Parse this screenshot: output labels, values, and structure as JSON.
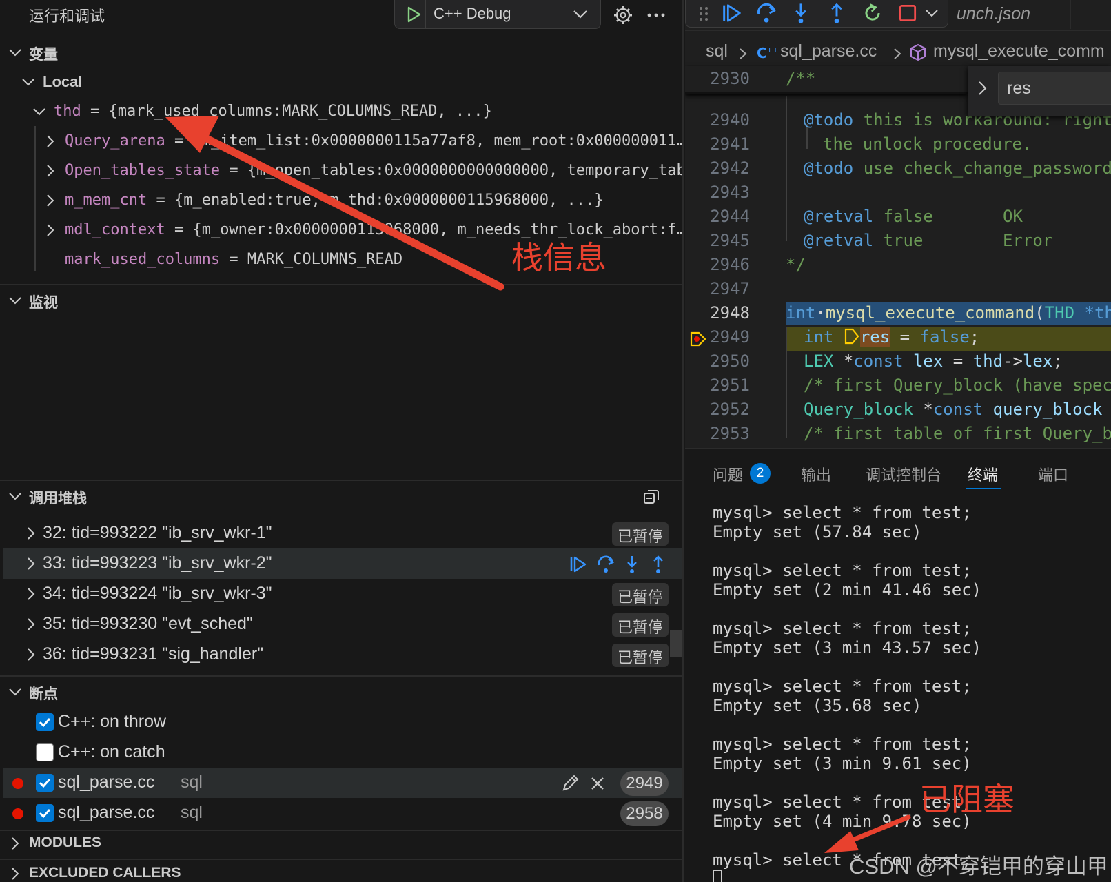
{
  "sidebar": {
    "title": "运行和调试",
    "launch_config": "C++ Debug",
    "sections": {
      "variables": "变量",
      "local": "Local",
      "watch": "监视",
      "call_stack": "调用堆栈",
      "breakpoints": "断点",
      "modules": "MODULES",
      "excluded_callers": "EXCLUDED CALLERS"
    }
  },
  "variables": {
    "thd": {
      "name": "thd",
      "value": "{mark_used_columns:MARK_COLUMNS_READ, ...}"
    },
    "children": [
      {
        "name": "Query_arena",
        "value": "{m_item_list:0x0000000115a77af8, mem_root:0x000000011…"
      },
      {
        "name": "Open_tables_state",
        "value": "{m_open_tables:0x0000000000000000, temporary_tabl…"
      },
      {
        "name": "m_mem_cnt",
        "value": "{m_enabled:true, m_thd:0x0000000115968000, ...}"
      },
      {
        "name": "mdl_context",
        "value": "{m_owner:0x0000000115968000, m_needs_thr_lock_abort:f…"
      },
      {
        "name": "mark_used_columns",
        "value": "MARK_COLUMNS_READ"
      }
    ]
  },
  "threads": [
    {
      "label": "32: tid=993222 \"ib_srv_wkr-1\"",
      "status": "已暂停"
    },
    {
      "label": "33: tid=993223 \"ib_srv_wkr-2\"",
      "status": ""
    },
    {
      "label": "34: tid=993224 \"ib_srv_wkr-3\"",
      "status": "已暂停"
    },
    {
      "label": "35: tid=993230 \"evt_sched\"",
      "status": "已暂停"
    },
    {
      "label": "36: tid=993231 \"sig_handler\"",
      "status": "已暂停"
    }
  ],
  "breakpoints": [
    {
      "label": "C++: on throw",
      "checked": true
    },
    {
      "label": "C++: on catch",
      "checked": false
    },
    {
      "label": "sql_parse.cc",
      "path": "sql",
      "line": "2949",
      "checked": true
    },
    {
      "label": "sql_parse.cc",
      "path": "sql",
      "line": "2958",
      "checked": true
    }
  ],
  "editor": {
    "tab_fragment": "unch.json",
    "breadcrumb": [
      "sql",
      "sql_parse.cc",
      "mysql_execute_comm"
    ],
    "sticky_line": {
      "num": "2930",
      "text": "/**"
    },
    "find_value": "res",
    "lines": [
      {
        "num": "2940",
        "text": "@todo this is workaround: right"
      },
      {
        "num": "2941",
        "text": "the unlock procedure."
      },
      {
        "num": "2942",
        "text": "@todo use check_change_password"
      },
      {
        "num": "2943",
        "text": ""
      },
      {
        "num": "2944",
        "text": "@retval false       OK"
      },
      {
        "num": "2945",
        "text": "@retval true        Error"
      },
      {
        "num": "2946",
        "text": "*/"
      },
      {
        "num": "2947",
        "text": ""
      },
      {
        "num": "2948",
        "text": "int mysql_execute_command(THD *th"
      },
      {
        "num": "2949",
        "text": "int res = false;"
      },
      {
        "num": "2950",
        "text": "LEX *const lex = thd->lex;"
      },
      {
        "num": "2951",
        "text": "/* first Query_block (have spec"
      },
      {
        "num": "2952",
        "text": "Query_block *const query_block"
      },
      {
        "num": "2953",
        "text": "/* first table of first Query_b"
      }
    ]
  },
  "panel": {
    "tabs": [
      "问题",
      "输出",
      "调试控制台",
      "终端",
      "端口"
    ],
    "problems_count": "2",
    "active_tab": "终端",
    "terminal": [
      "mysql> select * from test;",
      "Empty set (57.84 sec)",
      "",
      "mysql> select * from test;",
      "Empty set (2 min 41.46 sec)",
      "",
      "mysql> select * from test;",
      "Empty set (3 min 43.57 sec)",
      "",
      "mysql> select * from test;",
      "Empty set (35.68 sec)",
      "",
      "mysql> select * from test;",
      "Empty set (3 min 9.61 sec)",
      "",
      "mysql> select * from test;",
      "Empty set (4 min 9.78 sec)",
      "",
      "mysql> select * from test;"
    ]
  },
  "annotations": {
    "stack_info": "栈信息",
    "blocked": "已阻塞",
    "color": "#e8412e"
  },
  "watermark": "CSDN @不穿铠甲的穿山甲"
}
